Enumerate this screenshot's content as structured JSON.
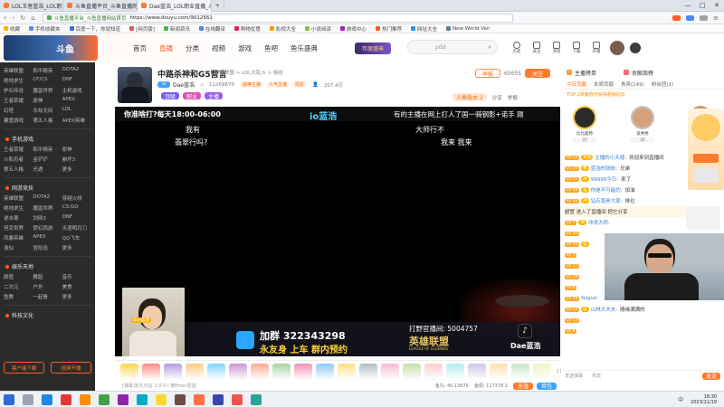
{
  "browser": {
    "tabs": [
      {
        "label": "LOL王者蓝浩_LOL职业直播视频",
        "color": "#ff7a2d",
        "active": false
      },
      {
        "label": "斗鱼直播平台_斗鱼直播网站首页",
        "color": "#ff7a2d",
        "active": false
      },
      {
        "label": "Dae蓝浩_LOL职业直播_斗鱼直播",
        "color": "#ff7a2d",
        "active": true
      },
      {
        "label": "",
        "color": "#bbb",
        "active": false
      }
    ],
    "url_prefix": "斗鱼直播平台_斗鱼直播网站首页",
    "url": "https://www.douyu.com/9012561",
    "bookmarks": [
      {
        "label": "收藏",
        "color": "#f5b400"
      },
      {
        "label": "手机收藏夹",
        "color": "#4c8bf5"
      },
      {
        "label": "百度一下，你就知道",
        "color": "#3b6fd8"
      },
      {
        "label": "[网页版]",
        "color": "#e05a4e"
      },
      {
        "label": "新闻资讯",
        "color": "#4caf50"
      },
      {
        "label": "在线翻译",
        "color": "#4c8bf5"
      },
      {
        "label": "购物优惠",
        "color": "#e91e63"
      },
      {
        "label": "影视大全",
        "color": "#ff9800"
      },
      {
        "label": "小说阅读",
        "color": "#8bc34a"
      },
      {
        "label": "游戏中心",
        "color": "#9c27b0"
      },
      {
        "label": "热门推荐",
        "color": "#ff5722"
      },
      {
        "label": "网址大全",
        "color": "#2196f3"
      },
      {
        "label": "New World Ven",
        "color": "#607d8b"
      }
    ],
    "window_controls": [
      "—",
      "□",
      "✕"
    ]
  },
  "site": {
    "logo": "斗鱼",
    "nav": [
      {
        "label": "首页",
        "active": false
      },
      {
        "label": "直播",
        "active": true
      },
      {
        "label": "分类",
        "active": false
      },
      {
        "label": "视频",
        "active": false
      },
      {
        "label": "游戏",
        "active": false
      },
      {
        "label": "鱼吧",
        "active": false
      },
      {
        "label": "鱼乐盛典",
        "active": false
      }
    ],
    "promo_badge": "年度盛典",
    "search_placeholder": "pdd",
    "header_icons": [
      "历史",
      "关注",
      "消息",
      "下载",
      "开播"
    ]
  },
  "sidebar": {
    "sections": [
      {
        "title": "",
        "items": [
          "英雄联盟",
          "和平精英",
          "DOTA2",
          "绝地求生",
          "CF/CS",
          "DNF",
          "炉石传说",
          "魔兽世界",
          "主机游戏",
          "王者荣耀",
          "原神",
          "APEX",
          "幻塔",
          "永劫无间",
          "LOL",
          "暴雪游戏",
          "第五人格",
          "APEX英雄"
        ]
      },
      {
        "title": "手机游戏",
        "items": [
          "王者荣耀",
          "和平精英",
          "原神",
          "火影忍者",
          "金铲铲",
          "崩坏3",
          "第五人格",
          "光遇",
          "更多"
        ]
      },
      {
        "title": "网游竞技",
        "items": [
          "英雄联盟",
          "DOTA2",
          "穿越火线",
          "绝地求生",
          "魔兽世界",
          "CS:GO",
          "逆水寒",
          "剑网3",
          "DNF",
          "坦克世界",
          "梦幻西游",
          "天涯明月刀",
          "风暴英雄",
          "APEX",
          "QQ飞车",
          "诛仙",
          "冒险岛",
          "更多"
        ]
      },
      {
        "title": "娱乐天地",
        "items": [
          "颜值",
          "舞蹈",
          "音乐",
          "二次元",
          "户外",
          "美食",
          "鱼教",
          "一起看",
          "更多"
        ]
      },
      {
        "title": "科技文化",
        "items": []
      }
    ],
    "buttons": [
      "客户端下载",
      "投屏开播"
    ]
  },
  "room": {
    "title": "中路杀神和G5营言",
    "tags": [
      "顶级",
      "职业",
      "主播"
    ],
    "category": "英雄联盟 > LOL大乱斗 > 峡谷",
    "anchor": "Dae蓝浩",
    "hot": "11269870",
    "follow_label": "关注",
    "follow_count": "65655",
    "share_label": "分享",
    "report_label": "举报",
    "badges": [
      "超神主播",
      "人气主播",
      "周星",
      "年度盛典"
    ],
    "pk_label": "斗鱼版本 2",
    "online": "207.4万"
  },
  "player": {
    "banner_left": "你准啥打?每天18:00-06:00",
    "banner_center": "io蓝浩",
    "banner_right": "有的主播在网上打人了国一骑钢影+诺手 刚",
    "danmu": [
      "我有",
      "翡翠行吗?",
      "大师行不",
      "我来 我来"
    ],
    "overlay_line1": "加群 322343298",
    "overlay_line2": "永友身 上车 群内预约",
    "overlay_qq": "打野官播间: 5004757",
    "overlay_brand": "英雄联盟",
    "overlay_brand_sub": "LEAGUE OF LEGENDS",
    "overlay_tiktok": "Dae蓝浩",
    "cam_label": "Dae蓝浩"
  },
  "giftbar": {
    "gifts": [
      "#ffd54f",
      "#ff8a80",
      "#b39ddb",
      "#ffcc80",
      "#81d4fa",
      "#ce93d8",
      "#ffab91",
      "#a5d6a7",
      "#f48fb1",
      "#90caf9",
      "#ffe082",
      "#b0bec5",
      "#f8bbd0",
      "#c5e1a5",
      "#ffcdd2",
      "#b2ebf2",
      "#d1c4e9",
      "#ffe0b2",
      "#c8e6c9",
      "#f0f4c3"
    ],
    "count": "1133",
    "coin_label": "鱼丸: 40.13876",
    "yuchi_label": "鱼翅: 117378.2",
    "recharge": "充值",
    "backpack": "背包"
  },
  "danmu_input": {
    "placeholder": "[弹幕]非礼勿言 2.0.0 / 按Enter发送",
    "send": "发送"
  },
  "right": {
    "rank_tabs": [
      "主播榜单",
      "贡献周榜"
    ],
    "subtabs": [
      "今日贡献",
      "本周贡献",
      "贵宾(149)",
      "粉丝团(1)"
    ],
    "top_note": "TOP 1贡献值可获得超级钻石",
    "rank_users": [
      {
        "name": "比比超特",
        "score": "37",
        "color": "#2a2a2a"
      },
      {
        "name": "爱秀秀",
        "score": "35",
        "color": "#d5a17c"
      },
      {
        "name": "安卓王者",
        "score": "33",
        "color": "#c98a6c"
      }
    ],
    "chat": [
      {
        "lv": "LV 13",
        "fan": "英雄",
        "user": "主播的小天使:",
        "msg": "欢迎来到直播间",
        "lvc": "#ffa726"
      },
      {
        "lv": "LV 25",
        "fan": "佛",
        "user": "蓝浩的铁粉:",
        "msg": "兄弟",
        "lvc": "#ffa726"
      },
      {
        "lv": "LV 11",
        "fan": "冲",
        "user": "99999今日:",
        "msg": "来了",
        "lvc": "#ffa726"
      },
      {
        "lv": "LV 18",
        "fan": "蓝",
        "user": "你是不可能的:",
        "msg": "加油",
        "lvc": "#ffa726"
      },
      {
        "lv": "LV 13",
        "fan": "冲",
        "user": "钻石尊贵大家:",
        "msg": "排位",
        "lvc": "#ffa726"
      },
      {
        "lv": "",
        "fan": "",
        "user": "",
        "msg": "超管 进入了直播间 把它分享",
        "lvc": "#ffa726"
      },
      {
        "lv": "LV 7",
        "fan": "佛",
        "user": "冲浪大师:",
        "msg": "",
        "lvc": "#ffa726"
      },
      {
        "lv": "LV 16",
        "fan": "",
        "user": "",
        "msg": "",
        "lvc": "#ffa726"
      },
      {
        "lv": "LV 16",
        "fan": "蓝",
        "user": "",
        "msg": "",
        "lvc": "#ffa726"
      },
      {
        "lv": "LV 7",
        "fan": "",
        "user": "",
        "msg": "",
        "lvc": "#ffa726"
      },
      {
        "lv": "LV 17",
        "fan": "",
        "user": "",
        "msg": "",
        "lvc": "#ffa726"
      },
      {
        "lv": "LV 19",
        "fan": "",
        "user": "",
        "msg": "",
        "lvc": "#ffa726"
      },
      {
        "lv": "LV 6",
        "fan": "",
        "user": "",
        "msg": "",
        "lvc": "#ffa726"
      },
      {
        "lv": "LV 16",
        "fan": "",
        "user": "feiguo:",
        "msg": "",
        "lvc": "#ffa726"
      },
      {
        "lv": "LV 13",
        "fan": "蓝",
        "user": "山林大木夫:",
        "msg": "随缘满满的",
        "lvc": "#ffa726"
      },
      {
        "lv": "LV 13",
        "fan": "",
        "user": "",
        "msg": "",
        "lvc": "#ffa726"
      },
      {
        "lv": "LV 8",
        "fan": "",
        "user": "",
        "msg": "",
        "lvc": "#ffa726"
      }
    ],
    "bottom_buttons": [
      "发送弹幕",
      "贵宾",
      "发送"
    ]
  },
  "taskbar": {
    "time": "18:30",
    "date": "2023/11/19",
    "tray": "中"
  }
}
